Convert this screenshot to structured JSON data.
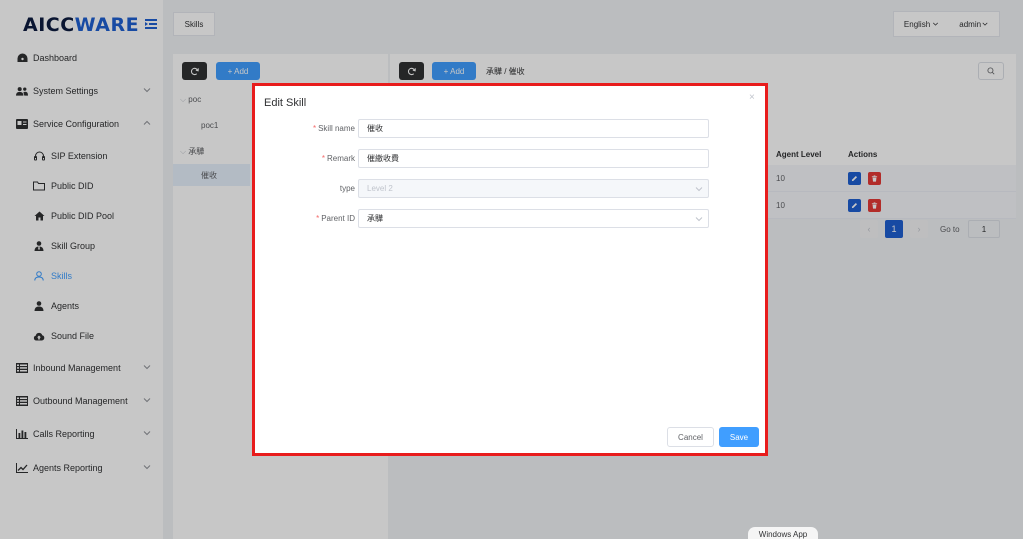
{
  "app": {
    "logo_main": "AICC",
    "logo_accent": "WARE"
  },
  "sidebar": {
    "items": [
      {
        "label": "Dashboard",
        "icon": "dashboard-icon"
      },
      {
        "label": "System Settings",
        "icon": "users-icon"
      },
      {
        "label": "Service Configuration",
        "icon": "id-card-icon"
      },
      {
        "label": "SIP Extension",
        "icon": "headset-icon"
      },
      {
        "label": "Public DID",
        "icon": "folder-icon"
      },
      {
        "label": "Public DID Pool",
        "icon": "home-icon"
      },
      {
        "label": "Skill Group",
        "icon": "user-tie-icon"
      },
      {
        "label": "Skills",
        "icon": "user-outline-icon"
      },
      {
        "label": "Agents",
        "icon": "user-icon"
      },
      {
        "label": "Sound File",
        "icon": "cloud-upload-icon"
      },
      {
        "label": "Inbound Management",
        "icon": "list-icon"
      },
      {
        "label": "Outbound Management",
        "icon": "list-icon"
      },
      {
        "label": "Calls Reporting",
        "icon": "bar-chart-icon"
      },
      {
        "label": "Agents Reporting",
        "icon": "line-chart-icon"
      }
    ]
  },
  "topbar": {
    "tab": "Skills",
    "language": "English",
    "user": "admin"
  },
  "left_panel": {
    "add_label": "+ Add",
    "tree": [
      "poc",
      "poc1",
      "承驊",
      "催收"
    ]
  },
  "right_panel": {
    "add_label": "+ Add",
    "breadcrumb": "承驊 / 催收",
    "columns": {
      "agent_level": "Agent Level",
      "actions": "Actions"
    },
    "rows": [
      {
        "agent_level": "10"
      },
      {
        "agent_level": "10"
      }
    ],
    "pager": {
      "page": "1",
      "goto_label": "Go to",
      "goto_value": "1"
    }
  },
  "dialog": {
    "title": "Edit Skill",
    "close": "×",
    "fields": {
      "skill_name": {
        "label": "Skill name",
        "value": "催收"
      },
      "remark": {
        "label": "Remark",
        "value": "催繳收費"
      },
      "type": {
        "label": "type",
        "value": "Level 2"
      },
      "parent_id": {
        "label": "Parent ID",
        "value": "承驊"
      }
    },
    "cancel": "Cancel",
    "save": "Save"
  },
  "taskbar": {
    "tooltip": "Windows App"
  },
  "colors": {
    "primary": "#409eff",
    "danger": "#e53935",
    "highlight": "#e81c1c",
    "logo_dark": "#0e1c3f",
    "logo_blue": "#1e5fd1"
  }
}
